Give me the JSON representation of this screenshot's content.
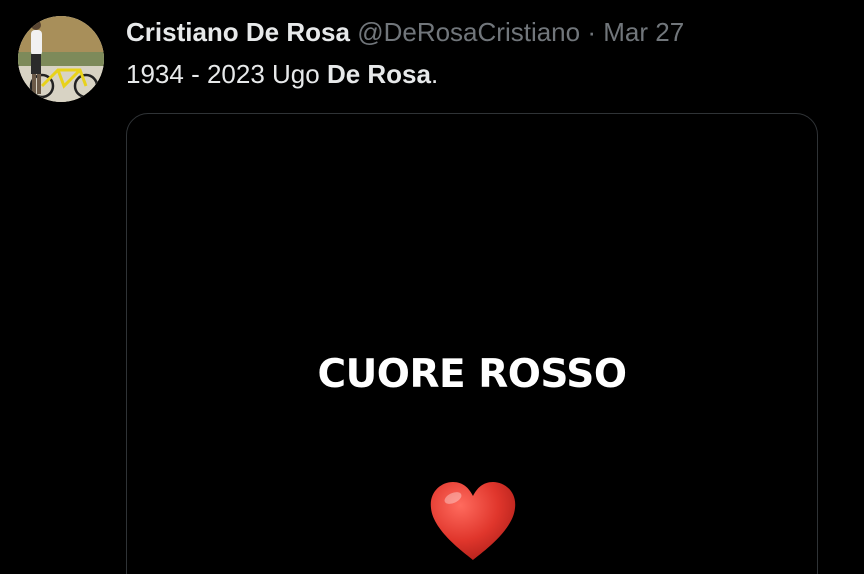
{
  "tweet": {
    "author_name": "Cristiano De Rosa",
    "author_handle": "@DeRosaCristiano",
    "separator": "·",
    "timestamp": "Mar 27",
    "text_plain": "1934 - 2023 Ugo ",
    "text_bold": "De Rosa",
    "text_end": "."
  },
  "media": {
    "title": "CUORE ROSSO",
    "emoji_icon": "red-heart-icon"
  },
  "colors": {
    "background": "#000000",
    "primary_text": "#e7e9ea",
    "secondary_text": "#71767b",
    "card_border": "#2f3336",
    "heart": "#e0362c"
  }
}
